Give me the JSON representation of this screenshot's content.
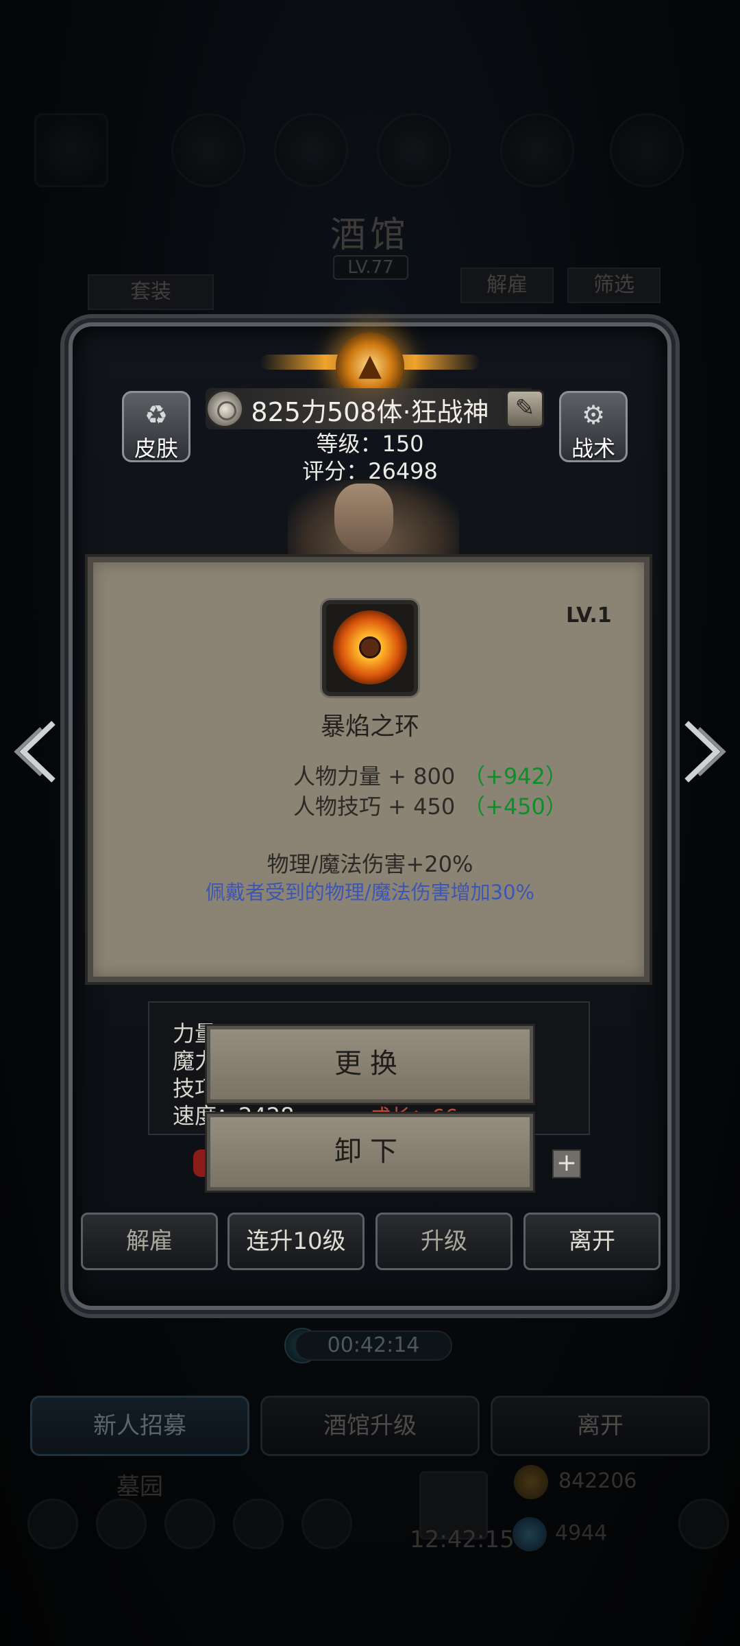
{
  "background": {
    "title": "酒馆",
    "level": "LV.77",
    "tab_left": "套装",
    "tab_dismiss": "解雇",
    "tab_filter": "筛选",
    "timer": "00:42:14",
    "nav_buttons": [
      "新人招募",
      "酒馆升级",
      "离开"
    ],
    "graveyard": "墓园",
    "clock": "12:42:15",
    "gold": "842206",
    "gems": "4944"
  },
  "hero": {
    "name": "825力508体·狂战神",
    "level": "等级：150",
    "score": "评分：26498",
    "skin_label": "皮肤",
    "tactics_label": "战术"
  },
  "item_card": {
    "level": "LV.1",
    "name": "暴焰之环",
    "attributes": [
      {
        "label": "人物力量 + 800",
        "bonus": "（+942）"
      },
      {
        "label": "人物技巧 + 450",
        "bonus": "（+450）"
      }
    ],
    "effect_main": "物理/魔法伤害+20%",
    "effect_sub": "佩戴者受到的物理/魔法伤害增加30%"
  },
  "stats_behind": {
    "lines": [
      "力量",
      "魔力",
      "技巧",
      "速度：2428"
    ],
    "right_text": "成长：66"
  },
  "actions": {
    "replace": "更换",
    "unequip": "卸下"
  },
  "bottom_buttons": [
    "解雇",
    "连升10级",
    "升级",
    "离开"
  ],
  "colors": {
    "card_bg": "#8b8475",
    "bonus_green": "#0c8f2a",
    "effect_blue": "#3d55b3",
    "emblem_gold": "#f0a32e"
  }
}
